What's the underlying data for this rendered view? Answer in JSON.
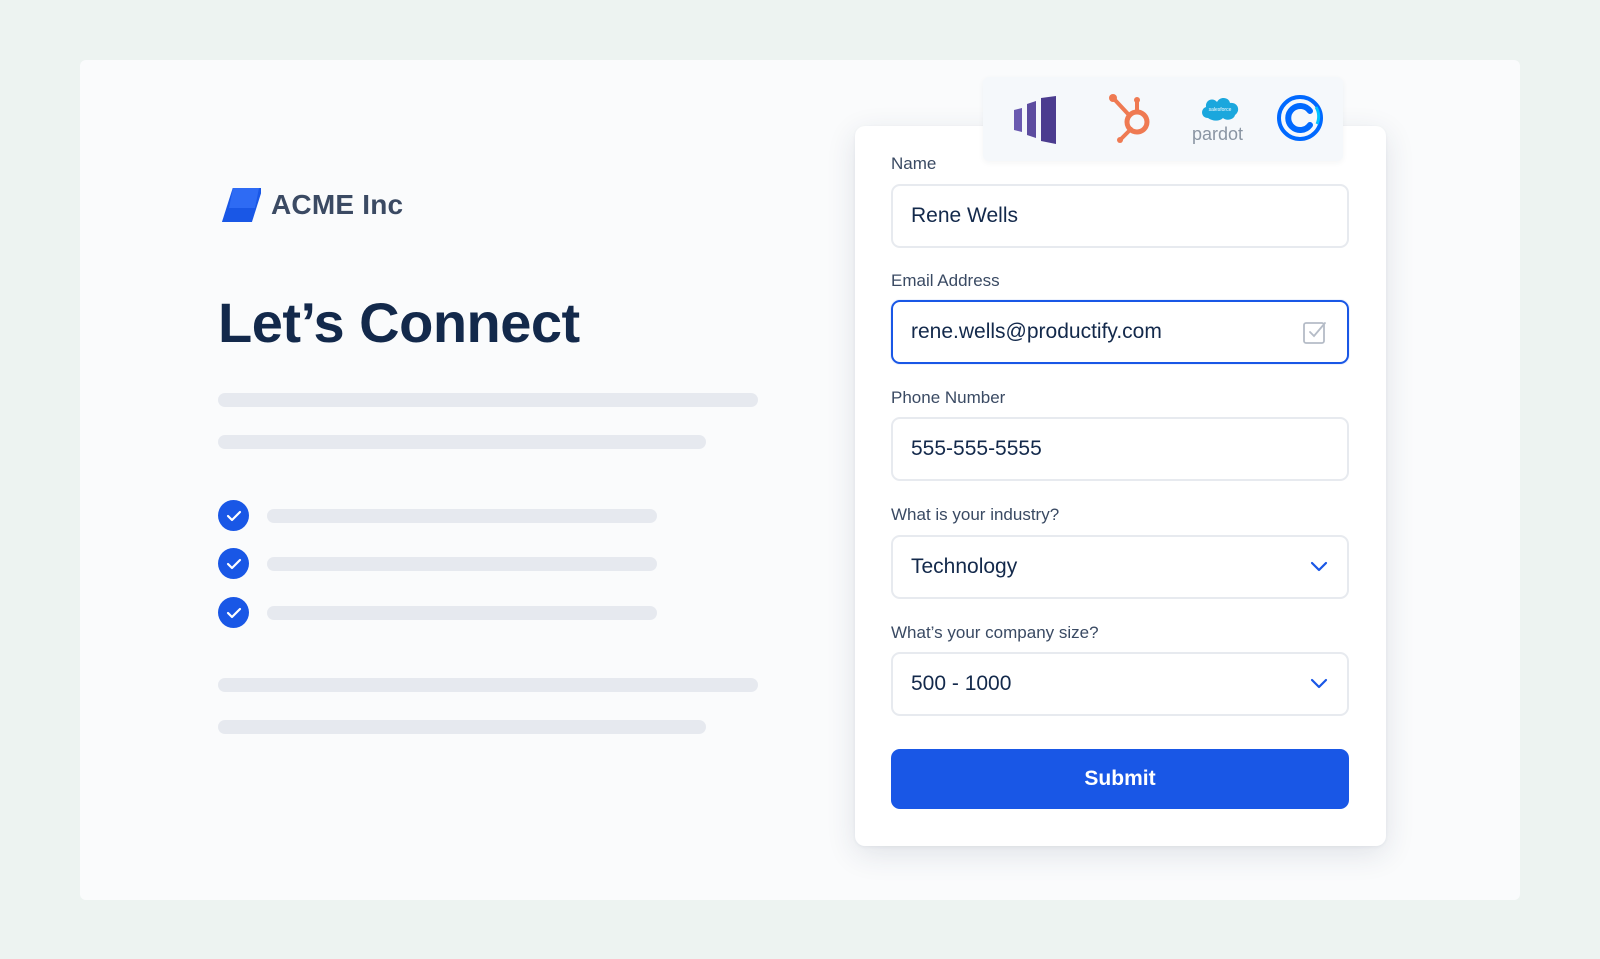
{
  "brand": {
    "name": "ACME Inc",
    "logo_icon": "acme-logo-icon",
    "accent": "#1957e6"
  },
  "hero": {
    "title": "Let’s Connect",
    "checklist_icons": [
      "check-circle-icon",
      "check-circle-icon",
      "check-circle-icon"
    ]
  },
  "integrations": {
    "items": [
      {
        "icon": "marketo-icon"
      },
      {
        "icon": "hubspot-icon"
      },
      {
        "icon": "salesforce-pardot-icon",
        "cloud_label": "salesforce",
        "label": "pardot"
      },
      {
        "icon": "calendly-icon"
      }
    ]
  },
  "form": {
    "name": {
      "label": "Name",
      "value": "Rene Wells"
    },
    "email": {
      "label": "Email Address",
      "value": "rene.wells@productify.com",
      "icon": "checkbox-icon"
    },
    "phone": {
      "label": "Phone Number",
      "value": "555-555-5555"
    },
    "industry": {
      "label": "What is your industry?",
      "value": "Technology",
      "icon": "chevron-down-icon"
    },
    "company_size": {
      "label": "What’s your company size?",
      "value": "500 - 1000",
      "icon": "chevron-down-icon"
    },
    "submit_label": "Submit"
  },
  "colors": {
    "background": "#edf3f1",
    "primary_button": "#1957e6",
    "title": "#13294b",
    "hubspot": "#ef7a52",
    "marketo": "#5c4c9f",
    "salesforce": "#1ba7dd",
    "calendly": "#0069ff"
  }
}
